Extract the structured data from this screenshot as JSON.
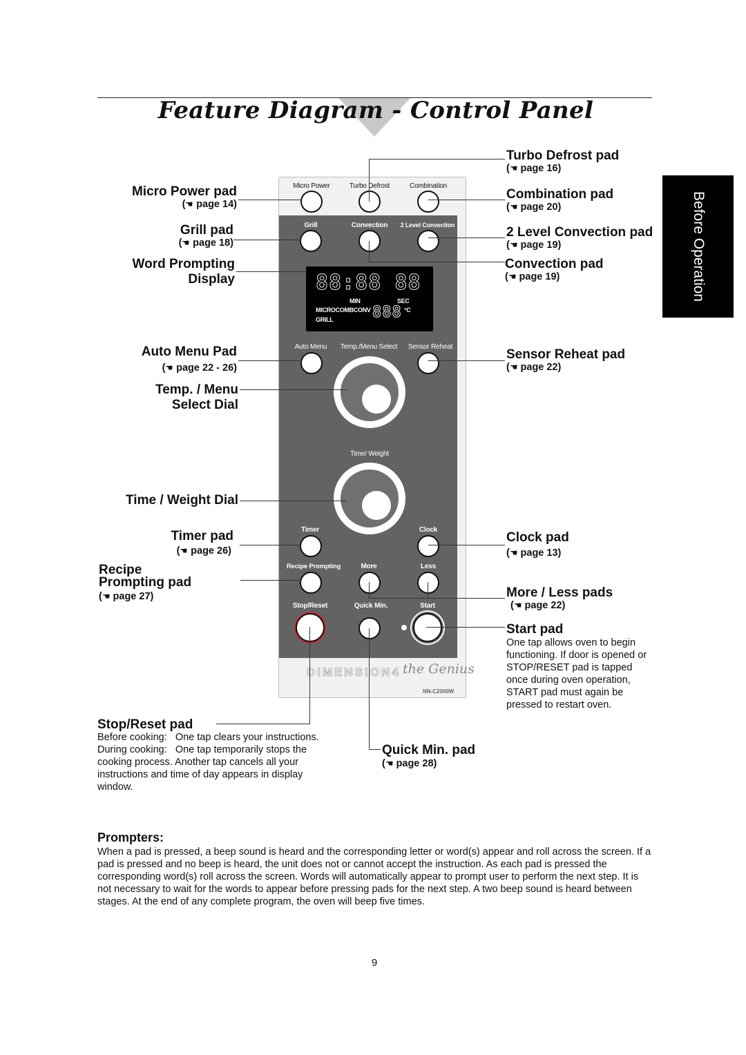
{
  "page": {
    "title": "Feature Diagram - Control Panel",
    "side_tab": "Before Operation",
    "page_number": "9",
    "page_ref_icon": "pointing-hand-icon"
  },
  "panel": {
    "pads": {
      "micro_power": "Micro Power",
      "turbo_defrost": "Turbo Defrost",
      "combination": "Combination",
      "grill": "Grill",
      "convection": "Convection",
      "two_level_convection": "2 Level Convection",
      "auto_menu": "Auto Menu",
      "temp_menu_select": "Temp./Menu Select",
      "sensor_reheat": "Sensor Reheat",
      "time_weight": "Time/ Weight",
      "timer": "Timer",
      "clock": "Clock",
      "recipe_prompting": "Recipe Prompting",
      "more": "More",
      "less": "Less",
      "stop_reset": "Stop/Reset",
      "quick_min": "Quick Min.",
      "start": "Start"
    },
    "display": {
      "digits": "88:88 88",
      "min": "MIN",
      "sec": "SEC",
      "modes": "MICROCOMBCONV",
      "grill": "GRILL",
      "temp_digits": "888",
      "temp_unit": "°C"
    },
    "brand": "DIMENSION4",
    "brand_script": "the Genius",
    "model": "NN-C2000W"
  },
  "callouts": {
    "micro_power": {
      "label": "Micro Power pad",
      "page": "page 14"
    },
    "grill": {
      "label": "Grill pad",
      "page": "page 18"
    },
    "word_prompting": {
      "label1": "Word Prompting",
      "label2": "Display"
    },
    "auto_menu": {
      "label": "Auto Menu Pad",
      "page": "page 22 - 26"
    },
    "temp_menu": {
      "label1": "Temp. / Menu",
      "label2": "Select Dial"
    },
    "time_weight": {
      "label": "Time / Weight Dial"
    },
    "timer": {
      "label": "Timer pad",
      "page": "page 26"
    },
    "recipe": {
      "label1": "Recipe",
      "label2": "Prompting pad",
      "page": "page 27"
    },
    "turbo_defrost": {
      "label": "Turbo Defrost pad",
      "page": "page 16"
    },
    "combination": {
      "label": "Combination pad",
      "page": "page 20"
    },
    "two_level": {
      "label": "2 Level Convection pad",
      "page": "page 19"
    },
    "convection": {
      "label": "Convection pad",
      "page": "page 19"
    },
    "sensor_reheat": {
      "label": "Sensor Reheat pad",
      "page": "page 22"
    },
    "clock": {
      "label": "Clock pad",
      "page": "page 13"
    },
    "more_less": {
      "label": "More / Less pads",
      "page": "page 22"
    },
    "start": {
      "label": "Start pad",
      "desc": "One tap allows oven to begin functioning. If door is opened or STOP/RESET pad is tapped once during oven operation, START pad must again be pressed to restart oven."
    },
    "stop_reset": {
      "label": "Stop/Reset pad",
      "line1": "Before cooking:   One tap clears your instructions.",
      "line2": "During cooking:   One tap temporarily stops the",
      "line3": "cooking process. Another tap cancels all your",
      "line4": "instructions and time of day appears in display",
      "line5": "window."
    },
    "quick_min": {
      "label": "Quick Min. pad",
      "page": "page 28"
    }
  },
  "prompters": {
    "heading": "Prompters:",
    "body": "When a pad is pressed, a beep sound is heard and the corresponding letter or word(s) appear and roll across the screen. If a pad is pressed and no beep is heard, the unit does not or cannot accept the instruction. As each pad is pressed the corresponding word(s) roll across the screen. Words will automatically appear to prompt user to perform the next step. It is not necessary to wait for the words to appear before pressing pads for the next step. A two beep sound is heard between stages. At the end of any complete program, the oven will beep five times."
  }
}
